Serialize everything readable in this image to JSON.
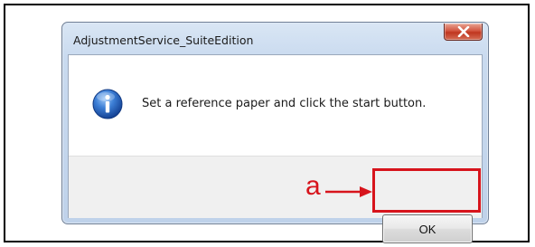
{
  "dialog": {
    "title": "AdjustmentService_SuiteEdition",
    "close_label": "X",
    "message": "Set a reference paper and click the start button.",
    "icon": "info-icon",
    "ok_label": "OK"
  },
  "annotation": {
    "callout_letter": "a",
    "color": "#d7141c"
  }
}
